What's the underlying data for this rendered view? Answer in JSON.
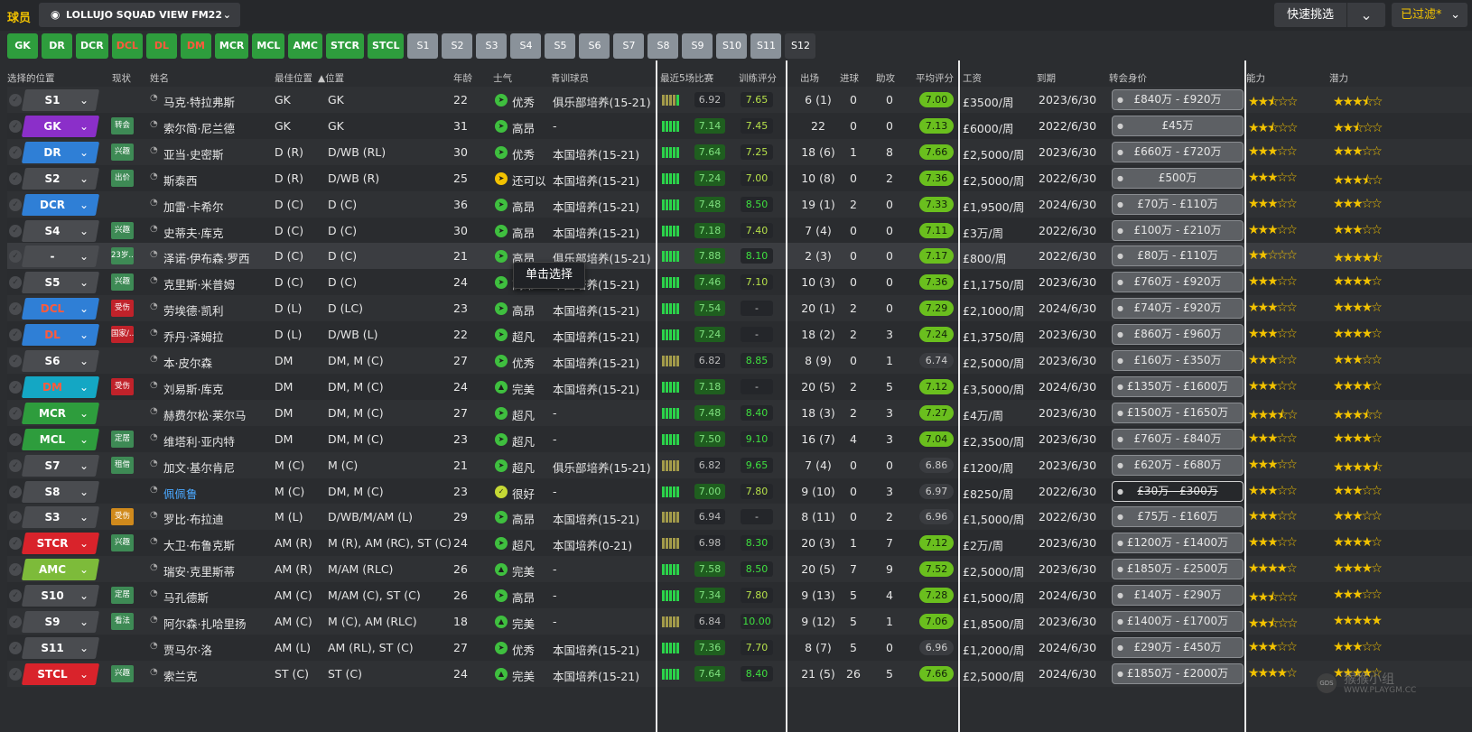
{
  "header": {
    "title": "球员",
    "view_name": "LOLLUJO SQUAD VIEW FM22",
    "quick_pick": "快速挑选",
    "filtered": "已过滤*"
  },
  "position_buttons": [
    {
      "label": "GK",
      "style": "g"
    },
    {
      "label": "DR",
      "style": "g"
    },
    {
      "label": "DCR",
      "style": "g"
    },
    {
      "label": "DCL",
      "style": "r"
    },
    {
      "label": "DL",
      "style": "r"
    },
    {
      "label": "DM",
      "style": "r"
    },
    {
      "label": "MCR",
      "style": "g"
    },
    {
      "label": "MCL",
      "style": "g"
    },
    {
      "label": "AMC",
      "style": "g"
    },
    {
      "label": "STCR",
      "style": "g"
    },
    {
      "label": "STCL",
      "style": "g"
    },
    {
      "label": "S1",
      "style": "s"
    },
    {
      "label": "S2",
      "style": "s"
    },
    {
      "label": "S3",
      "style": "s"
    },
    {
      "label": "S4",
      "style": "s"
    },
    {
      "label": "S5",
      "style": "s"
    },
    {
      "label": "S6",
      "style": "s"
    },
    {
      "label": "S7",
      "style": "s"
    },
    {
      "label": "S8",
      "style": "s"
    },
    {
      "label": "S9",
      "style": "s"
    },
    {
      "label": "S10",
      "style": "s"
    },
    {
      "label": "S11",
      "style": "s"
    },
    {
      "label": "S12",
      "style": "s last"
    }
  ],
  "columns": {
    "selected_position": "选择的位置",
    "status": "现状",
    "name": "姓名",
    "best_position": "最佳位置",
    "position": "▲位置",
    "age": "年龄",
    "morale": "士气",
    "youth": "青训球员",
    "form": "最近5场比赛",
    "training": "训练评分",
    "apps": "出场",
    "goals": "进球",
    "assists": "助攻",
    "avg_rating": "平均评分",
    "wage": "工资",
    "expires": "到期",
    "transfer_value": "转会身价",
    "ability": "能力",
    "potential": "潜力"
  },
  "tooltip": "单击选择",
  "watermark": {
    "line1": "猴猴小组",
    "line2": "WWW.PLAYGM.CC",
    "logo": "GDS"
  },
  "colors": {
    "green": "#2e9d3d",
    "purple": "#8b2fc9",
    "blue": "#2f7fd6",
    "red": "#d9232b",
    "teal": "#14a7c4",
    "lime": "#7dbb3a",
    "gray": "#4a4c50",
    "gold": "#f2c200",
    "rating_green": "#6abf1e"
  },
  "players": [
    {
      "sel": "S1",
      "selColor": "#4a4c50",
      "selText": "#fff",
      "status": "",
      "statusColor": "",
      "name": "马克·特拉弗斯",
      "best": "GK",
      "pos": "GK",
      "age": "22",
      "moraleIcon": "up",
      "morale": "优秀",
      "youth": "俱乐部培养(15-21)",
      "form": [
        "o",
        "o",
        "o",
        "o",
        "g"
      ],
      "formRating": "6.92",
      "formGood": false,
      "training": "7.65",
      "apps": "6 (1)",
      "goals": "0",
      "assists": "0",
      "avg": "7.00",
      "avgGood": true,
      "wage": "£3500/周",
      "expires": "2023/6/30",
      "value": "£840万 - £920万",
      "valueAlt": false,
      "ability": "★★⯪☆☆",
      "potential": "★★★⯪☆"
    },
    {
      "sel": "GK",
      "selColor": "#8b2fc9",
      "selText": "#fff",
      "status": "转会",
      "statusColor": "#3e8a55",
      "name": "索尔简·尼兰德",
      "best": "GK",
      "pos": "GK",
      "age": "31",
      "moraleIcon": "up",
      "morale": "高昂",
      "youth": "-",
      "form": [
        "g",
        "g",
        "g",
        "g",
        "g"
      ],
      "formRating": "7.14",
      "formGood": true,
      "training": "7.45",
      "apps": "22",
      "goals": "0",
      "assists": "0",
      "avg": "7.13",
      "avgGood": true,
      "wage": "£6000/周",
      "expires": "2022/6/30",
      "value": "£45万",
      "valueAlt": false,
      "ability": "★★⯪☆☆",
      "potential": "★★⯪☆☆"
    },
    {
      "sel": "DR",
      "selColor": "#2f7fd6",
      "selText": "#fff",
      "status": "兴趣",
      "statusColor": "#3e8a55",
      "name": "亚当·史密斯",
      "best": "D (R)",
      "pos": "D/WB (RL)",
      "age": "30",
      "moraleIcon": "up",
      "morale": "优秀",
      "youth": "本国培养(15-21)",
      "form": [
        "g",
        "g",
        "g",
        "g",
        "g"
      ],
      "formRating": "7.64",
      "formGood": true,
      "training": "7.25",
      "apps": "18 (6)",
      "goals": "1",
      "assists": "8",
      "avg": "7.66",
      "avgGood": true,
      "wage": "£2,5000/周",
      "expires": "2023/6/30",
      "value": "£660万 - £720万",
      "valueAlt": false,
      "ability": "★★★☆☆",
      "potential": "★★★☆☆"
    },
    {
      "sel": "S2",
      "selColor": "#4a4c50",
      "selText": "#fff",
      "status": "出价",
      "statusColor": "#3e8a55",
      "name": "斯泰西",
      "best": "D (R)",
      "pos": "D/WB (R)",
      "age": "25",
      "moraleIcon": "mid",
      "morale": "还可以",
      "youth": "本国培养(15-21)",
      "form": [
        "g",
        "g",
        "g",
        "g",
        "g"
      ],
      "formRating": "7.24",
      "formGood": true,
      "training": "7.00",
      "apps": "10 (8)",
      "goals": "0",
      "assists": "2",
      "avg": "7.36",
      "avgGood": true,
      "wage": "£2,5000/周",
      "expires": "2022/6/30",
      "value": "£500万",
      "valueAlt": false,
      "ability": "★★★☆☆",
      "potential": "★★★⯪☆"
    },
    {
      "sel": "DCR",
      "selColor": "#2f7fd6",
      "selText": "#fff",
      "status": "",
      "statusColor": "",
      "name": "加雷·卡希尔",
      "best": "D (C)",
      "pos": "D (C)",
      "age": "36",
      "moraleIcon": "up",
      "morale": "高昂",
      "youth": "本国培养(15-21)",
      "form": [
        "g",
        "g",
        "g",
        "g",
        "g"
      ],
      "formRating": "7.48",
      "formGood": true,
      "training": "8.50",
      "apps": "19 (1)",
      "goals": "2",
      "assists": "0",
      "avg": "7.33",
      "avgGood": true,
      "wage": "£1,9500/周",
      "expires": "2024/6/30",
      "value": "£70万 - £110万",
      "valueAlt": false,
      "ability": "★★★☆☆",
      "potential": "★★★☆☆"
    },
    {
      "sel": "S4",
      "selColor": "#4a4c50",
      "selText": "#fff",
      "status": "兴趣",
      "statusColor": "#3e8a55",
      "name": "史蒂夫·库克",
      "best": "D (C)",
      "pos": "D (C)",
      "age": "30",
      "moraleIcon": "up",
      "morale": "高昂",
      "youth": "本国培养(15-21)",
      "form": [
        "g",
        "g",
        "g",
        "g",
        "g"
      ],
      "formRating": "7.18",
      "formGood": true,
      "training": "7.40",
      "apps": "7 (4)",
      "goals": "0",
      "assists": "0",
      "avg": "7.11",
      "avgGood": true,
      "wage": "£3万/周",
      "expires": "2022/6/30",
      "value": "£100万 - £210万",
      "valueAlt": false,
      "ability": "★★★☆☆",
      "potential": "★★★☆☆"
    },
    {
      "sel": "-",
      "selColor": "#4a4c50",
      "selText": "#fff",
      "status": "23岁...",
      "statusColor": "#3e8a55",
      "name": "泽诺·伊布森·罗西",
      "best": "D (C)",
      "pos": "D (C)",
      "age": "21",
      "moraleIcon": "up",
      "morale": "高昂",
      "youth": "俱乐部培养(15-21)",
      "form": [
        "g",
        "g",
        "g",
        "g",
        "g"
      ],
      "formRating": "7.88",
      "formGood": true,
      "training": "8.10",
      "apps": "2 (3)",
      "goals": "0",
      "assists": "0",
      "avg": "7.17",
      "avgGood": true,
      "wage": "£800/周",
      "expires": "2022/6/30",
      "value": "£80万 - £110万",
      "valueAlt": false,
      "ability": "★★☆☆☆",
      "potential": "★★★★⯪"
    },
    {
      "sel": "S5",
      "selColor": "#4a4c50",
      "selText": "#fff",
      "status": "兴趣",
      "statusColor": "#3e8a55",
      "name": "克里斯·米普姆",
      "best": "D (C)",
      "pos": "D (C)",
      "age": "24",
      "moraleIcon": "up",
      "morale": "高昂",
      "youth": "本国培养(15-21)",
      "form": [
        "g",
        "g",
        "g",
        "g",
        "g"
      ],
      "formRating": "7.46",
      "formGood": true,
      "training": "7.10",
      "apps": "10 (3)",
      "goals": "0",
      "assists": "0",
      "avg": "7.36",
      "avgGood": true,
      "wage": "£1,1750/周",
      "expires": "2023/6/30",
      "value": "£760万 - £920万",
      "valueAlt": false,
      "ability": "★★★☆☆",
      "potential": "★★★★☆"
    },
    {
      "sel": "DCL",
      "selColor": "#2f7fd6",
      "selText": "#ff5a3c",
      "status": "受伤",
      "statusColor": "#c0222a",
      "name": "劳埃德·凯利",
      "best": "D (L)",
      "pos": "D (LC)",
      "age": "23",
      "moraleIcon": "up",
      "morale": "高昂",
      "youth": "本国培养(15-21)",
      "form": [
        "g",
        "g",
        "g",
        "g",
        "g"
      ],
      "formRating": "7.54",
      "formGood": true,
      "training": "-",
      "apps": "20 (1)",
      "goals": "2",
      "assists": "0",
      "avg": "7.29",
      "avgGood": true,
      "wage": "£2,1000/周",
      "expires": "2024/6/30",
      "value": "£740万 - £920万",
      "valueAlt": false,
      "ability": "★★★☆☆",
      "potential": "★★★★☆"
    },
    {
      "sel": "DL",
      "selColor": "#2f7fd6",
      "selText": "#ff5a3c",
      "status": "国家/...",
      "statusColor": "#c0222a",
      "name": "乔丹·泽姆拉",
      "best": "D (L)",
      "pos": "D/WB (L)",
      "age": "22",
      "moraleIcon": "up",
      "morale": "超凡",
      "youth": "本国培养(15-21)",
      "form": [
        "g",
        "g",
        "g",
        "g",
        "g"
      ],
      "formRating": "7.24",
      "formGood": true,
      "training": "-",
      "apps": "18 (2)",
      "goals": "2",
      "assists": "3",
      "avg": "7.24",
      "avgGood": true,
      "wage": "£1,3750/周",
      "expires": "2023/6/30",
      "value": "£860万 - £960万",
      "valueAlt": false,
      "ability": "★★★☆☆",
      "potential": "★★★★☆"
    },
    {
      "sel": "S6",
      "selColor": "#4a4c50",
      "selText": "#fff",
      "status": "",
      "statusColor": "",
      "name": "本·皮尔森",
      "best": "DM",
      "pos": "DM, M (C)",
      "age": "27",
      "moraleIcon": "up",
      "morale": "优秀",
      "youth": "本国培养(15-21)",
      "form": [
        "o",
        "o",
        "o",
        "o",
        "o"
      ],
      "formRating": "6.82",
      "formGood": false,
      "training": "8.85",
      "apps": "8 (9)",
      "goals": "0",
      "assists": "1",
      "avg": "6.74",
      "avgGood": false,
      "wage": "£2,5000/周",
      "expires": "2023/6/30",
      "value": "£160万 - £350万",
      "valueAlt": false,
      "ability": "★★★☆☆",
      "potential": "★★★☆☆"
    },
    {
      "sel": "DM",
      "selColor": "#14a7c4",
      "selText": "#ff5a3c",
      "status": "受伤",
      "statusColor": "#c0222a",
      "name": "刘易斯·库克",
      "best": "DM",
      "pos": "DM, M (C)",
      "age": "24",
      "moraleIcon": "top",
      "morale": "完美",
      "youth": "本国培养(15-21)",
      "form": [
        "g",
        "g",
        "g",
        "g",
        "g"
      ],
      "formRating": "7.18",
      "formGood": true,
      "training": "-",
      "apps": "20 (5)",
      "goals": "2",
      "assists": "5",
      "avg": "7.12",
      "avgGood": true,
      "wage": "£3,5000/周",
      "expires": "2024/6/30",
      "value": "£1350万 - £1600万",
      "valueAlt": false,
      "ability": "★★★☆☆",
      "potential": "★★★★☆"
    },
    {
      "sel": "MCR",
      "selColor": "#2e9d3d",
      "selText": "#fff",
      "status": "",
      "statusColor": "",
      "name": "赫费尔松·莱尔马",
      "best": "DM",
      "pos": "DM, M (C)",
      "age": "27",
      "moraleIcon": "up",
      "morale": "超凡",
      "youth": "-",
      "form": [
        "g",
        "g",
        "g",
        "g",
        "g"
      ],
      "formRating": "7.48",
      "formGood": true,
      "training": "8.40",
      "apps": "18 (3)",
      "goals": "2",
      "assists": "3",
      "avg": "7.27",
      "avgGood": true,
      "wage": "£4万/周",
      "expires": "2023/6/30",
      "value": "£1500万 - £1650万",
      "valueAlt": false,
      "ability": "★★★⯪☆",
      "potential": "★★★⯪☆"
    },
    {
      "sel": "MCL",
      "selColor": "#2e9d3d",
      "selText": "#fff",
      "status": "定居",
      "statusColor": "#3e8a55",
      "name": "维塔利·亚内特",
      "best": "DM",
      "pos": "DM, M (C)",
      "age": "23",
      "moraleIcon": "up",
      "morale": "超凡",
      "youth": "-",
      "form": [
        "g",
        "g",
        "g",
        "g",
        "g"
      ],
      "formRating": "7.50",
      "formGood": true,
      "training": "9.10",
      "apps": "16 (7)",
      "goals": "4",
      "assists": "3",
      "avg": "7.04",
      "avgGood": true,
      "wage": "£2,3500/周",
      "expires": "2023/6/30",
      "value": "£760万 - £840万",
      "valueAlt": false,
      "ability": "★★★☆☆",
      "potential": "★★★★☆"
    },
    {
      "sel": "S7",
      "selColor": "#4a4c50",
      "selText": "#fff",
      "status": "租借",
      "statusColor": "#3e8a55",
      "name": "加文·基尔肯尼",
      "best": "M (C)",
      "pos": "M (C)",
      "age": "21",
      "moraleIcon": "up",
      "morale": "超凡",
      "youth": "俱乐部培养(15-21)",
      "form": [
        "o",
        "o",
        "o",
        "o",
        "o"
      ],
      "formRating": "6.82",
      "formGood": false,
      "training": "9.65",
      "apps": "7 (4)",
      "goals": "0",
      "assists": "0",
      "avg": "6.86",
      "avgGood": false,
      "wage": "£1200/周",
      "expires": "2023/6/30",
      "value": "£620万 - £680万",
      "valueAlt": false,
      "ability": "★★★☆☆",
      "potential": "★★★★⯪"
    },
    {
      "sel": "S8",
      "selColor": "#4a4c50",
      "selText": "#fff",
      "status": "",
      "statusColor": "",
      "name": "佩佩鲁",
      "best": "M (C)",
      "pos": "DM, M (C)",
      "age": "23",
      "moraleIcon": "good",
      "morale": "很好",
      "youth": "-",
      "form": [
        "g",
        "g",
        "g",
        "g",
        "g"
      ],
      "formRating": "7.00",
      "formGood": true,
      "training": "7.80",
      "apps": "9 (10)",
      "goals": "0",
      "assists": "3",
      "avg": "6.97",
      "avgGood": false,
      "wage": "£8250/周",
      "expires": "2022/6/30",
      "value": "£30万 - £300万",
      "valueAlt": true,
      "ability": "★★★☆☆",
      "potential": "★★★☆☆",
      "nameBlue": true
    },
    {
      "sel": "S3",
      "selColor": "#4a4c50",
      "selText": "#fff",
      "status": "受伤",
      "statusColor": "#d08a1c",
      "name": "罗比·布拉迪",
      "best": "M (L)",
      "pos": "D/WB/M/AM (L)",
      "age": "29",
      "moraleIcon": "up",
      "morale": "高昂",
      "youth": "本国培养(15-21)",
      "form": [
        "o",
        "o",
        "o",
        "o",
        "o"
      ],
      "formRating": "6.94",
      "formGood": false,
      "training": "-",
      "apps": "8 (11)",
      "goals": "0",
      "assists": "2",
      "avg": "6.96",
      "avgGood": false,
      "wage": "£1,5000/周",
      "expires": "2022/6/30",
      "value": "£75万 - £160万",
      "valueAlt": false,
      "ability": "★★★☆☆",
      "potential": "★★★☆☆"
    },
    {
      "sel": "STCR",
      "selColor": "#d9232b",
      "selText": "#fff",
      "status": "兴趣",
      "statusColor": "#3e8a55",
      "name": "大卫·布鲁克斯",
      "best": "AM (R)",
      "pos": "M (R), AM (RC), ST (C)",
      "age": "24",
      "moraleIcon": "up",
      "morale": "超凡",
      "youth": "本国培养(0-21)",
      "form": [
        "o",
        "o",
        "o",
        "o",
        "o"
      ],
      "formRating": "6.98",
      "formGood": false,
      "training": "8.30",
      "apps": "20 (3)",
      "goals": "1",
      "assists": "7",
      "avg": "7.12",
      "avgGood": true,
      "wage": "£2万/周",
      "expires": "2023/6/30",
      "value": "£1200万 - £1400万",
      "valueAlt": false,
      "ability": "★★★☆☆",
      "potential": "★★★★☆"
    },
    {
      "sel": "AMC",
      "selColor": "#7dbb3a",
      "selText": "#fff",
      "status": "",
      "statusColor": "",
      "name": "瑞安·克里斯蒂",
      "best": "AM (R)",
      "pos": "M/AM (RLC)",
      "age": "26",
      "moraleIcon": "top",
      "morale": "完美",
      "youth": "-",
      "form": [
        "g",
        "g",
        "g",
        "g",
        "g"
      ],
      "formRating": "7.58",
      "formGood": true,
      "training": "8.50",
      "apps": "20 (5)",
      "goals": "7",
      "assists": "9",
      "avg": "7.52",
      "avgGood": true,
      "wage": "£2,5000/周",
      "expires": "2023/6/30",
      "value": "£1850万 - £2500万",
      "valueAlt": false,
      "ability": "★★★★☆",
      "potential": "★★★★☆"
    },
    {
      "sel": "S10",
      "selColor": "#4a4c50",
      "selText": "#fff",
      "status": "定居",
      "statusColor": "#3e8a55",
      "name": "马孔德斯",
      "best": "AM (C)",
      "pos": "M/AM (C), ST (C)",
      "age": "26",
      "moraleIcon": "up",
      "morale": "高昂",
      "youth": "-",
      "form": [
        "g",
        "g",
        "g",
        "g",
        "g"
      ],
      "formRating": "7.34",
      "formGood": true,
      "training": "7.80",
      "apps": "9 (13)",
      "goals": "5",
      "assists": "4",
      "avg": "7.28",
      "avgGood": true,
      "wage": "£1,5000/周",
      "expires": "2024/6/30",
      "value": "£140万 - £290万",
      "valueAlt": false,
      "ability": "★★⯪☆☆",
      "potential": "★★★☆☆"
    },
    {
      "sel": "S9",
      "selColor": "#4a4c50",
      "selText": "#fff",
      "status": "看法",
      "statusColor": "#3e8a55",
      "name": "阿尔森·扎哈里扬",
      "best": "AM (C)",
      "pos": "M (C), AM (RLC)",
      "age": "18",
      "moraleIcon": "top",
      "morale": "完美",
      "youth": "-",
      "form": [
        "o",
        "o",
        "o",
        "o",
        "o"
      ],
      "formRating": "6.84",
      "formGood": false,
      "training": "10.00",
      "apps": "9 (12)",
      "goals": "5",
      "assists": "1",
      "avg": "7.06",
      "avgGood": true,
      "wage": "£1,8500/周",
      "expires": "2023/6/30",
      "value": "£1400万 - £1700万",
      "valueAlt": false,
      "ability": "★★⯪☆☆",
      "potential": "★★★★★"
    },
    {
      "sel": "S11",
      "selColor": "#4a4c50",
      "selText": "#fff",
      "status": "",
      "statusColor": "",
      "name": "贾马尔·洛",
      "best": "AM (L)",
      "pos": "AM (RL), ST (C)",
      "age": "27",
      "moraleIcon": "up",
      "morale": "优秀",
      "youth": "本国培养(15-21)",
      "form": [
        "g",
        "g",
        "g",
        "g",
        "g"
      ],
      "formRating": "7.36",
      "formGood": true,
      "training": "7.70",
      "apps": "8 (7)",
      "goals": "5",
      "assists": "0",
      "avg": "6.96",
      "avgGood": false,
      "wage": "£1,2000/周",
      "expires": "2024/6/30",
      "value": "£290万 - £450万",
      "valueAlt": false,
      "ability": "★★★☆☆",
      "potential": "★★★☆☆"
    },
    {
      "sel": "STCL",
      "selColor": "#d9232b",
      "selText": "#fff",
      "status": "兴趣",
      "statusColor": "#3e8a55",
      "name": "索兰克",
      "best": "ST (C)",
      "pos": "ST (C)",
      "age": "24",
      "moraleIcon": "top",
      "morale": "完美",
      "youth": "本国培养(15-21)",
      "form": [
        "g",
        "g",
        "g",
        "g",
        "g"
      ],
      "formRating": "7.64",
      "formGood": true,
      "training": "8.40",
      "apps": "21 (5)",
      "goals": "26",
      "assists": "5",
      "avg": "7.66",
      "avgGood": true,
      "wage": "£2,5000/周",
      "expires": "2024/6/30",
      "value": "£1850万 - £2000万",
      "valueAlt": false,
      "ability": "★★★★☆",
      "potential": "★★★★☆"
    }
  ]
}
